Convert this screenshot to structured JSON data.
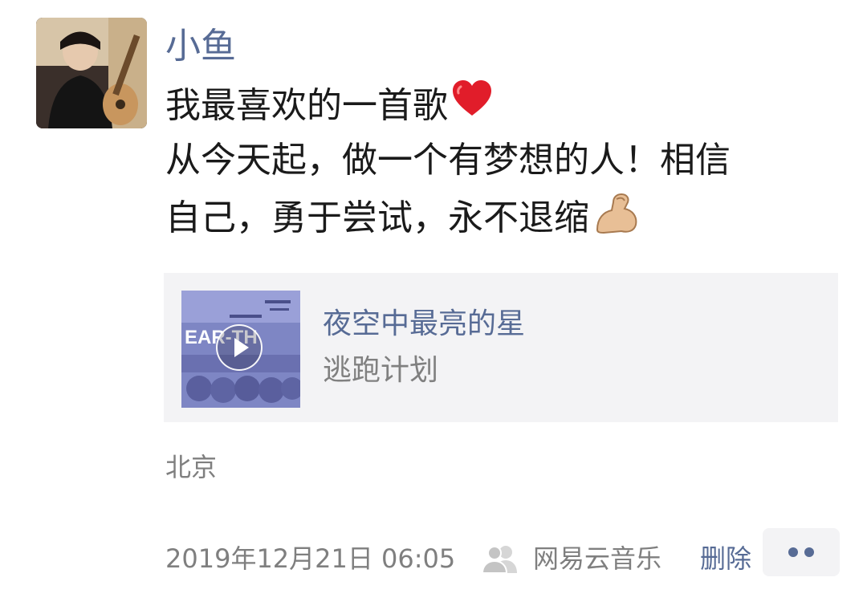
{
  "post": {
    "author": "小鱼",
    "text_lines": [
      "我最喜欢的一首歌",
      "从今天起，做一个有梦想的人！相信",
      "自己，勇于尝试，永不退缩"
    ],
    "emojis": [
      "red-heart",
      "flexed-biceps"
    ],
    "location": "北京",
    "timestamp": "2019年12月21日 06:05",
    "source": "网易云音乐",
    "delete_label": "删除"
  },
  "music": {
    "title": "夜空中最亮的星",
    "artist": "逃跑计划",
    "album_art_text": "EAR-TH"
  },
  "colors": {
    "link": "#576b95",
    "text": "#1a1a1a",
    "meta": "#7f7f7f",
    "card_bg": "#f3f3f5"
  }
}
